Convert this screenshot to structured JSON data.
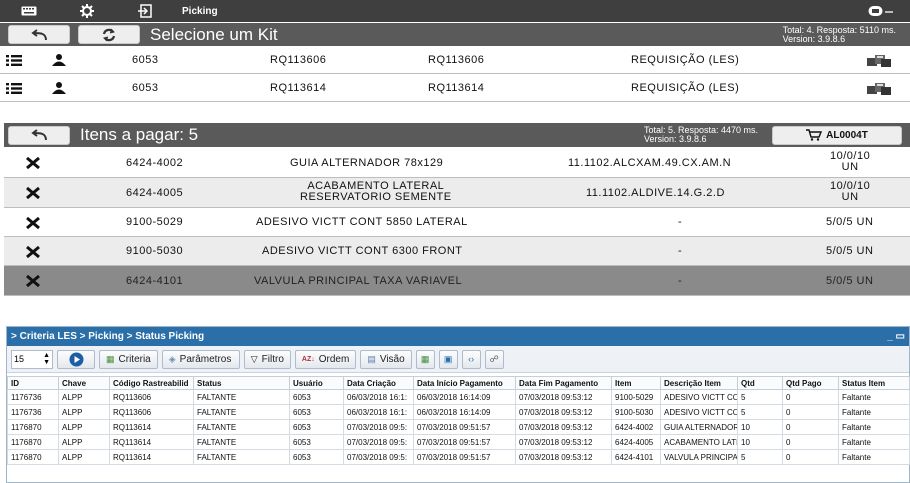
{
  "topbar": {
    "title": "Picking",
    "icons": [
      "keyboard-icon",
      "gear-icon",
      "exit-icon",
      "connection-icon"
    ]
  },
  "kit_panel": {
    "title": "Selecione um Kit",
    "status_line1": "Total: 4. Resposta: 5110 ms.",
    "status_line2": "Version: 3.9.8.6",
    "rows": [
      {
        "user": "6053",
        "code_a": "RQ113606",
        "code_b": "RQ113606",
        "type": "REQUISIÇÃO (LES)"
      },
      {
        "user": "6053",
        "code_a": "RQ113614",
        "code_b": "RQ113614",
        "type": "REQUISIÇÃO (LES)"
      }
    ]
  },
  "items_panel": {
    "title": "Itens a pagar: 5",
    "status_line1": "Total: 5. Resposta: 4470 ms.",
    "status_line2": "Version: 3.9.8.6",
    "cart_label": "AL0004T",
    "rows": [
      {
        "item": "6424-4002",
        "desc": "GUIA ALTERNADOR 78x129",
        "desc2": "",
        "loc": "11.1102.ALCXAM.49.CX.AM.N",
        "qty": "10/0/10",
        "qty2": "UN"
      },
      {
        "item": "6424-4005",
        "desc": "ACABAMENTO LATERAL",
        "desc2": "RESERVATORIO SEMENTE",
        "loc": "11.1102.ALDIVE.14.G.2.D",
        "qty": "10/0/10",
        "qty2": "UN"
      },
      {
        "item": "9100-5029",
        "desc": "ADESIVO VICTT CONT 5850 LATERAL",
        "desc2": "",
        "loc": "-",
        "qty": "5/0/5 UN",
        "qty2": ""
      },
      {
        "item": "9100-5030",
        "desc": "ADESIVO VICTT CONT 6300 FRONT",
        "desc2": "",
        "loc": "-",
        "qty": "5/0/5 UN",
        "qty2": ""
      },
      {
        "item": "6424-4101",
        "desc": "VALVULA PRINCIPAL TAXA VARIAVEL",
        "desc2": "",
        "loc": "-",
        "qty": "5/0/5 UN",
        "qty2": ""
      }
    ]
  },
  "erp": {
    "breadcrumb": "> Criteria LES > Picking > Status Picking",
    "page_size": "15",
    "buttons": {
      "criteria": "Criteria",
      "parametros": "Parâmetros",
      "filtro": "Filtro",
      "ordem": "Ordem",
      "visao": "Visão"
    },
    "columns": [
      "ID",
      "Chave",
      "Código Rastreabilid",
      "Status",
      "Usuário",
      "Data Criação",
      "Data Início Pagamento",
      "Data Fim Pagamento",
      "Item",
      "Descrição Item",
      "Qtd",
      "Qtd Pago",
      "Status Item"
    ],
    "rows": [
      [
        "1176736",
        "ALPP",
        "RQ113606",
        "FALTANTE",
        "6053",
        "06/03/2018 16:1:",
        "06/03/2018 16:14:09",
        "07/03/2018 09:53:12",
        "9100-5029",
        "ADESIVO VICTT CO",
        "5",
        "0",
        "Faltante"
      ],
      [
        "1176736",
        "ALPP",
        "RQ113606",
        "FALTANTE",
        "6053",
        "06/03/2018 16:1:",
        "06/03/2018 16:14:09",
        "07/03/2018 09:53:12",
        "9100-5030",
        "ADESIVO VICTT CO",
        "5",
        "0",
        "Faltante"
      ],
      [
        "1176870",
        "ALPP",
        "RQ113614",
        "FALTANTE",
        "6053",
        "07/03/2018 09:5:",
        "07/03/2018 09:51:57",
        "07/03/2018 09:53:12",
        "6424-4002",
        "GUIA ALTERNADOR",
        "10",
        "0",
        "Faltante"
      ],
      [
        "1176870",
        "ALPP",
        "RQ113614",
        "FALTANTE",
        "6053",
        "07/03/2018 09:5:",
        "07/03/2018 09:51:57",
        "07/03/2018 09:53:12",
        "6424-4005",
        "ACABAMENTO LATE",
        "10",
        "0",
        "Faltante"
      ],
      [
        "1176870",
        "ALPP",
        "RQ113614",
        "FALTANTE",
        "6053",
        "07/03/2018 09:5:",
        "07/03/2018 09:51:57",
        "07/03/2018 09:53:12",
        "6424-4101",
        "VALVULA PRINCIPAI",
        "5",
        "0",
        "Faltante"
      ]
    ]
  }
}
